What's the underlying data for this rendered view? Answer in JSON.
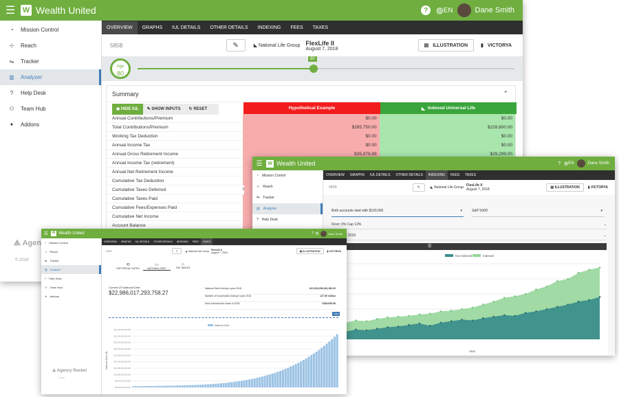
{
  "brand": "Wealth United",
  "user": {
    "name": "Dane Smith",
    "lang": "EN"
  },
  "nav": [
    "Mission Control",
    "Reach",
    "Tracker",
    "Analyzer",
    "Help Desk",
    "Team Hub",
    "Addons"
  ],
  "tabs": [
    "Overview",
    "Graphs",
    "IUL Details",
    "Other Details",
    "Indexing",
    "Fees",
    "Taxes"
  ],
  "case_id": "585B",
  "product": {
    "name": "FlexLife II",
    "date": "August 7, 2018",
    "carrier": "National Life Group"
  },
  "actions": {
    "illustration": "ILLUSTRATION",
    "victorya": "VICTORYA"
  },
  "age": {
    "label": "Age",
    "value": "80",
    "marker": "80"
  },
  "summary": {
    "title": "Summary",
    "buttons": {
      "hide": "HIDE IUL",
      "show": "SHOW INPUTS",
      "reset": "RESET"
    },
    "col_hypo": "Hypothetical Example",
    "col_iul": "Indexed Universal Life",
    "rows": [
      {
        "label": "Annual Contributions/Premium",
        "hypo": "$0.00",
        "iul": "$0.00"
      },
      {
        "label": "Total Contributions/Premium",
        "hypo": "$285,750.00",
        "iul": "$228,600.00"
      },
      {
        "label": "Working Tax Deduction",
        "hypo": "$0.00",
        "iul": "$0.00"
      },
      {
        "label": "Annual Income Tax",
        "hypo": "$0.00",
        "iul": "$0.00"
      },
      {
        "label": "Annual Gross Retirement Income",
        "hypo": "$35,978.89",
        "iul": "$29,299.00"
      },
      {
        "label": "Annual Income Tax (retirement)",
        "hypo": "",
        "iul": ""
      },
      {
        "label": "Annual Net Retirement Income",
        "hypo": "",
        "iul": ""
      },
      {
        "label": "Cumulative Tax Deduction",
        "hypo": "",
        "iul": ""
      },
      {
        "label": "Cumulative Taxes Deferred",
        "sup": "2",
        "hypo": "",
        "iul": ""
      },
      {
        "label": "Cumulative Taxes Paid",
        "hypo": "",
        "iul": ""
      },
      {
        "label": "Cumulative Fees/Expenses Paid",
        "hypo": "",
        "iul": ""
      },
      {
        "label": "Cumulative Net Income",
        "hypo": "",
        "iul": ""
      },
      {
        "label": "Account Balance",
        "hypo": "",
        "iul": ""
      }
    ]
  },
  "footer": {
    "company": "Agency Rocket",
    "copyright": "© 2019"
  },
  "indexing": {
    "accounts_select": "Both accounts start with $100,000",
    "index_select": "S&P 500®",
    "floor_cap": "Floor: 0% Cap 12%",
    "range": "ge: 2000 - 2018",
    "legend": [
      "Not Indexed",
      "Indexed"
    ],
    "xlabel": "Year",
    "series_colors": [
      "#3c8f8c",
      "#97d69b"
    ]
  },
  "debt": {
    "tabs": [
      "HISTORICAL RATES",
      "NATIONAL DEBT",
      "TAX TABLES"
    ],
    "current_label": "Current US National Debt",
    "current_value": "$22,986,017,293,758.27",
    "stats": [
      {
        "label": "National Debt ending in year 2018",
        "value": "$21,516,058,183,180.00"
      },
      {
        "label": "Number of households ending in year 2018",
        "value": "127.59 million"
      },
      {
        "label": "Each Household's share in 2018",
        "value": "$168,636.56"
      }
    ],
    "legend": "National Debt",
    "ylabel": "National Debt ($)",
    "yticks": [
      "$24,000,000,000,000",
      "$22,000,000,000,000",
      "$20,000,000,000,000",
      "$18,000,000,000,000",
      "$16,000,000,000,000",
      "$14,000,000,000,000",
      "$12,000,000,000,000",
      "$10,000,000,000,000",
      "$8,000,000,000,000",
      "$6,000,000,000,000"
    ],
    "slider_marker": "2018"
  }
}
